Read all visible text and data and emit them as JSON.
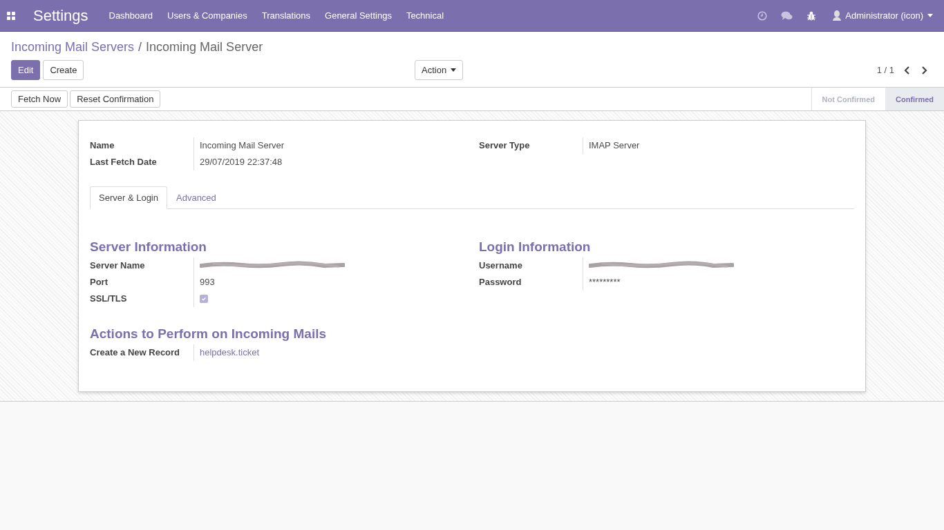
{
  "navbar": {
    "app_title": "Settings",
    "menu": [
      "Dashboard",
      "Users & Companies",
      "Translations",
      "General Settings",
      "Technical"
    ],
    "user": "Administrator (icon)"
  },
  "breadcrumb": {
    "parent": "Incoming Mail Servers",
    "separator": "/",
    "current": "Incoming Mail Server"
  },
  "buttons": [
    {
      "label": "Edit",
      "kind": "primary"
    },
    {
      "label": "Create",
      "kind": "secondary"
    }
  ],
  "action_menu": {
    "label": "Action"
  },
  "pager": {
    "value": "1 / 1"
  },
  "header_buttons": [
    "Fetch Now",
    "Reset Confirmation"
  ],
  "stages": [
    {
      "label": "Not Confirmed",
      "selected": false
    },
    {
      "label": "Confirmed",
      "selected": true
    }
  ],
  "header_fields": {
    "left": [
      {
        "label": "Name",
        "kind": "text",
        "value": "Incoming Mail Server"
      },
      {
        "label": "Last Fetch Date",
        "kind": "text",
        "value": "29/07/2019 22:37:48"
      }
    ],
    "right": [
      {
        "label": "Server Type",
        "kind": "text",
        "value": "IMAP Server"
      }
    ]
  },
  "tabs": [
    {
      "label": "Server & Login",
      "selected": true
    },
    {
      "label": "Advanced",
      "selected": false
    }
  ],
  "server_information": {
    "title": "Server Information",
    "fields": [
      {
        "label": "Server Name",
        "kind": "redacted"
      },
      {
        "label": "Port",
        "kind": "text",
        "value": "993"
      },
      {
        "label": "SSL/TLS",
        "kind": "checkbox",
        "checked": true
      }
    ]
  },
  "login_information": {
    "title": "Login Information",
    "fields": [
      {
        "label": "Username",
        "kind": "redacted"
      },
      {
        "label": "Password",
        "kind": "text",
        "value": "*********"
      }
    ]
  },
  "actions": {
    "title": "Actions to Perform on Incoming Mails",
    "fields": [
      {
        "label": "Create a New Record",
        "kind": "link",
        "value": "helpdesk.ticket"
      }
    ]
  }
}
